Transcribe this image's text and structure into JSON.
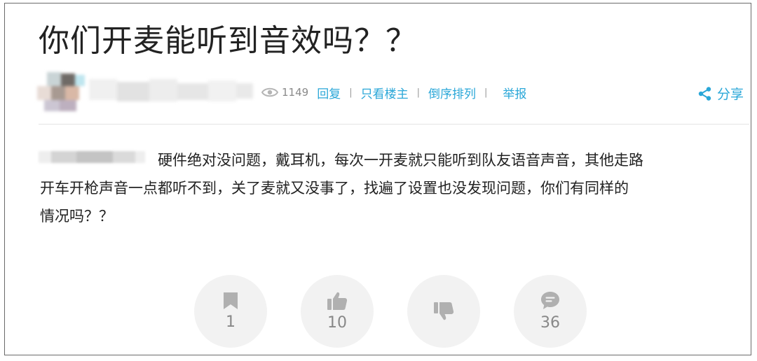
{
  "post": {
    "title": "你们开麦能听到音效吗？？",
    "body_line1": "硬件绝对没问题，戴耳机，每次一开麦就只能听到队友语音声音，其他走路",
    "body_line2": "开车开枪声音一点都听不到，关了麦就又没事了，找遍了设置也没发现问题，你们有同样的",
    "body_line3": "情况吗？？"
  },
  "meta": {
    "views": "1149",
    "reply": "回复",
    "only_op": "只看楼主",
    "reverse_order": "倒序排列",
    "report": "举报",
    "share": "分享"
  },
  "actions": {
    "bookmark_count": "1",
    "like_count": "10",
    "comment_count": "36"
  },
  "colors": {
    "accent": "#2aa7d8",
    "icon_gray": "#b0b0b0",
    "circle_bg": "#f2f2f2"
  },
  "icons": [
    "eye-icon",
    "share-icon",
    "bookmark-icon",
    "thumbs-up-icon",
    "thumbs-down-icon",
    "comment-icon"
  ]
}
